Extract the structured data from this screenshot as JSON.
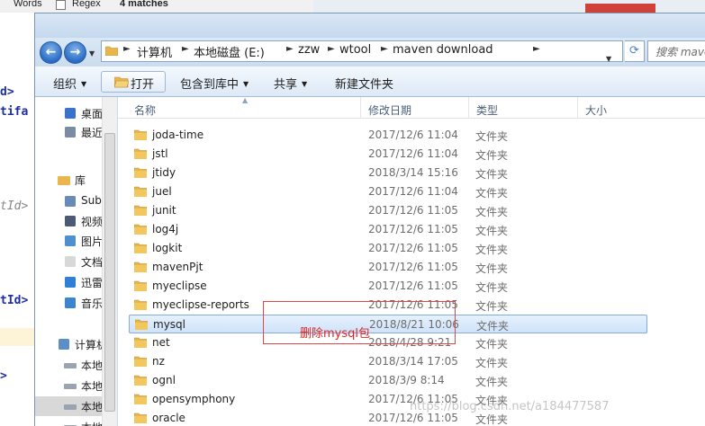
{
  "background": {
    "find_bar": {
      "words": "Words",
      "regex": "Regex",
      "matches": "4 matches"
    },
    "code_fragments": [
      "d>",
      "tifa",
      "tId>",
      "tId>",
      ">"
    ]
  },
  "address_bar": {
    "crumbs": [
      "计算机",
      "本地磁盘 (E:)",
      "zzw",
      "wtool",
      "maven download"
    ],
    "search_placeholder": "搜索 maven"
  },
  "toolbar": {
    "organize": "组织",
    "open": "打开",
    "include_in_library": "包含到库中",
    "share": "共享",
    "new_folder": "新建文件夹"
  },
  "nav_pane": {
    "items": [
      {
        "label": "桌面",
        "icon": "desktop-icon"
      },
      {
        "label": "最近访问的位置",
        "icon": "recent-icon"
      },
      {
        "label": "库",
        "icon": "library-icon"
      },
      {
        "label": "Subversion",
        "icon": "svn-icon"
      },
      {
        "label": "视频",
        "icon": "video-icon"
      },
      {
        "label": "图片",
        "icon": "picture-icon"
      },
      {
        "label": "文档",
        "icon": "document-icon"
      },
      {
        "label": "迅雷下载",
        "icon": "download-icon"
      },
      {
        "label": "音乐",
        "icon": "music-icon"
      },
      {
        "label": "计算机",
        "icon": "computer-icon"
      },
      {
        "label": "本地磁盘",
        "icon": "drive-icon"
      },
      {
        "label": "本地磁盘",
        "icon": "drive-icon"
      },
      {
        "label": "本地磁盘",
        "icon": "drive-icon"
      },
      {
        "label": "本地磁盘",
        "icon": "drive-icon"
      }
    ]
  },
  "file_list": {
    "columns": {
      "name": "名称",
      "modified": "修改日期",
      "type": "类型",
      "size": "大小"
    },
    "rows": [
      {
        "name": "joda-time",
        "modified": "2017/12/6 11:04",
        "type": "文件夹"
      },
      {
        "name": "jstl",
        "modified": "2017/12/6 11:04",
        "type": "文件夹"
      },
      {
        "name": "jtidy",
        "modified": "2018/3/14 15:16",
        "type": "文件夹"
      },
      {
        "name": "juel",
        "modified": "2017/12/6 11:04",
        "type": "文件夹"
      },
      {
        "name": "junit",
        "modified": "2017/12/6 11:05",
        "type": "文件夹"
      },
      {
        "name": "log4j",
        "modified": "2017/12/6 11:05",
        "type": "文件夹"
      },
      {
        "name": "logkit",
        "modified": "2017/12/6 11:05",
        "type": "文件夹"
      },
      {
        "name": "mavenPjt",
        "modified": "2017/12/6 11:05",
        "type": "文件夹"
      },
      {
        "name": "myeclipse",
        "modified": "2017/12/6 11:05",
        "type": "文件夹"
      },
      {
        "name": "myeclipse-reports",
        "modified": "2017/12/6 11:05",
        "type": "文件夹"
      },
      {
        "name": "mysql",
        "modified": "2018/8/21 10:06",
        "type": "文件夹",
        "selected": true
      },
      {
        "name": "net",
        "modified": "2018/4/28 9:21",
        "type": "文件夹"
      },
      {
        "name": "nz",
        "modified": "2018/3/14 17:05",
        "type": "文件夹"
      },
      {
        "name": "ognl",
        "modified": "2018/3/9 8:14",
        "type": "文件夹"
      },
      {
        "name": "opensymphony",
        "modified": "2017/12/6 11:05",
        "type": "文件夹"
      },
      {
        "name": "oracle",
        "modified": "2017/12/6 11:05",
        "type": "文件夹"
      }
    ]
  },
  "annotation": {
    "text": "删除mysql包"
  },
  "watermark": "https://blog.csdn.net/a184477587",
  "colors": {
    "accent": "#2a6cc5",
    "selection": "#cfe3fa",
    "annotation": "#e02424",
    "folder": "#e8b64c"
  }
}
